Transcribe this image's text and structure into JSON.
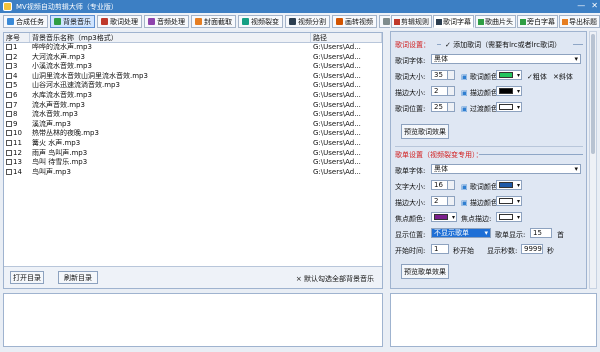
{
  "window": {
    "title": "MV视频自动剪辑大师（专业版）"
  },
  "toolbar": [
    {
      "label": "合成任务",
      "color": "#3a8ad8"
    },
    {
      "label": "背景音乐",
      "color": "#2f9e44"
    },
    {
      "label": "歌词处理",
      "color": "#c0392b"
    },
    {
      "label": "音频处理",
      "color": "#8e44ad"
    },
    {
      "label": "封面截取",
      "color": "#e67e22"
    },
    {
      "label": "视频裂变",
      "color": "#16a085"
    },
    {
      "label": "视频分割",
      "color": "#2c3e50"
    },
    {
      "label": "画转视频",
      "color": "#d35400"
    },
    {
      "label": "视频拆剪",
      "color": "#7f8c8d"
    }
  ],
  "table": {
    "headers": [
      "序号",
      "背景音乐名称（mp3格式）",
      "路径"
    ],
    "rows": [
      {
        "no": "1",
        "name": "哗哗的流水声.mp3",
        "path": "G:\\Users\\Ad..."
      },
      {
        "no": "2",
        "name": "大河流水声.mp3",
        "path": "G:\\Users\\Ad..."
      },
      {
        "no": "3",
        "name": "小溪流水音效.mp3",
        "path": "G:\\Users\\Ad..."
      },
      {
        "no": "4",
        "name": "山洞里流水音效山洞里流水音效.mp3",
        "path": "G:\\Users\\Ad..."
      },
      {
        "no": "5",
        "name": "山谷河水迅速流淌音效.mp3",
        "path": "G:\\Users\\Ad..."
      },
      {
        "no": "6",
        "name": "水库流水音效.mp3",
        "path": "G:\\Users\\Ad..."
      },
      {
        "no": "7",
        "name": "流水声音效.mp3",
        "path": "G:\\Users\\Ad..."
      },
      {
        "no": "8",
        "name": "流水音效.mp3",
        "path": "G:\\Users\\Ad..."
      },
      {
        "no": "9",
        "name": "溪流声.mp3",
        "path": "G:\\Users\\Ad..."
      },
      {
        "no": "10",
        "name": "热带丛林的夜晚.mp3",
        "path": "G:\\Users\\Ad..."
      },
      {
        "no": "11",
        "name": "篝火 水声.mp3",
        "path": "G:\\Users\\Ad..."
      },
      {
        "no": "12",
        "name": "雨声 鸟叫声.mp3",
        "path": "G:\\Users\\Ad..."
      },
      {
        "no": "13",
        "name": "鸟叫 待雪乐.mp3",
        "path": "G:\\Users\\Ad..."
      },
      {
        "no": "14",
        "name": "鸟叫声.mp3",
        "path": "G:\\Users\\Ad..."
      }
    ]
  },
  "left_footer": {
    "open_btn": "打开目录",
    "refresh_btn": "刷新目录",
    "note": "× 默认勾选全部背景音乐"
  },
  "right_tabs": [
    {
      "label": "剪辑规则",
      "color": "#c0392b"
    },
    {
      "label": "歌词字幕",
      "color": "#2c3e50"
    },
    {
      "label": "歌曲片头",
      "color": "#2f9e44"
    },
    {
      "label": "旁白字幕",
      "color": "#2f9e44"
    },
    {
      "label": "导出标题",
      "color": "#e67e22"
    }
  ],
  "lyrics": {
    "section": "歌词设置：",
    "add_lyrics": "添加歌词（需要有lrc或者lrc歌词）",
    "font_label": "歌词字体:",
    "font_value": "黑体",
    "size_label": "歌词大小:",
    "size_value": "35",
    "color_label": "歌词颜色:",
    "color_value": "#22c55e",
    "bold": "粗体",
    "italic": "斜体",
    "stroke_label": "描边大小:",
    "stroke_value": "2",
    "stroke_color_label": "描边颜色:",
    "stroke_color_value": "#000000",
    "pos_label": "歌词位置:",
    "pos_value": "25",
    "transition_label": "过渡颜色:",
    "transition_color_value": "#ffffff",
    "preview_btn": "预览歌词效果"
  },
  "playlist": {
    "section": "歌单设置（视频裂变专用）：",
    "font_label": "歌单字体:",
    "font_value": "黑体",
    "size_label": "文字大小:",
    "size_value": "16",
    "color_label": "歌词颜色:",
    "color_value": "#1f5aa8",
    "stroke_label": "描边大小:",
    "stroke_value": "2",
    "stroke_color_label": "描边颜色:",
    "stroke_color_value": "#ffffff",
    "focus_color_label": "焦点颜色:",
    "focus_color_value": "#7a1f8c",
    "focus_stroke_label": "焦点描边:",
    "focus_stroke_value": "#ffffff",
    "display_pos_label": "显示位置:",
    "display_pos_value": "不显示歌单",
    "show_count_label": "歌单显示:",
    "show_count_value": "15",
    "show_count_unit": "首",
    "start_label": "开始时间:",
    "start_value": "1",
    "start_unit": "秒开始",
    "duration_label": "显示秒数:",
    "duration_value": "9999",
    "duration_unit": "秒",
    "preview_btn": "预览歌单效果"
  }
}
